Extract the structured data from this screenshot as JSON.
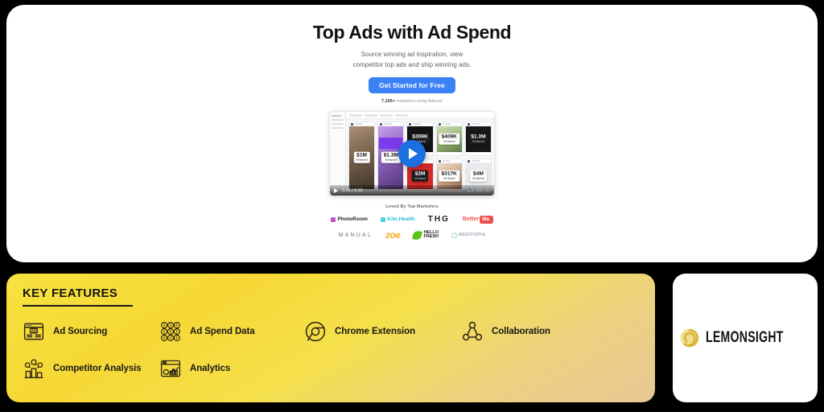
{
  "hero": {
    "title": "Top Ads with Ad Spend",
    "subtitle_line1": "Source winning ad inspiration, view",
    "subtitle_line2": "competitor top ads and ship winning ads.",
    "cta_label": "Get Started for Free",
    "social_proof_count": "7,100+",
    "social_proof_text": " marketers using Adscan",
    "accent_color": "#3b82f6"
  },
  "video": {
    "play_label": "Play",
    "current_time": "0:00",
    "duration": "6:32",
    "time_display": "0:00 / 6:32",
    "volume_icon": "volume-icon",
    "fullscreen_icon": "fullscreen-icon",
    "settings_icon": "more-options-icon",
    "ad_cards": [
      {
        "amount": "$1M",
        "label": "Ad Spend"
      },
      {
        "amount": "$1.3M",
        "label": "Ad Spend"
      },
      {
        "amount": "$309K",
        "label": "Ad Spend"
      },
      {
        "amount": "$409K",
        "label": "Ad Spend"
      },
      {
        "amount": "$1.3M",
        "label": "Ad Spend"
      },
      {
        "amount": "$2M",
        "label": "Ad Spend"
      },
      {
        "amount": "$317K",
        "label": "Ad Spend"
      },
      {
        "amount": "$4M",
        "label": "Ad Spend"
      }
    ]
  },
  "social": {
    "heading": "Loved By Top Marketers",
    "row1": [
      {
        "name": "PhotoRoom",
        "icon": "photoroom-logo"
      },
      {
        "name": "Kilo.Health",
        "icon": "kilohealth-logo"
      },
      {
        "name": "THG",
        "icon": "thg-logo"
      },
      {
        "name": "Better",
        "badge": "Me.",
        "icon": "betterme-logo"
      }
    ],
    "row2": [
      {
        "name": "MANUAL",
        "icon": "manual-logo"
      },
      {
        "name": "zoe",
        "icon": "zoe-logo"
      },
      {
        "name": "HELLO",
        "name2": "FRESH",
        "icon": "hellofresh-logo"
      },
      {
        "name": "MEDITOPIA",
        "icon": "meditopia-logo"
      }
    ]
  },
  "features": {
    "heading": "KEY FEATURES",
    "items": [
      {
        "label": "Ad Sourcing",
        "icon": "ad-window-icon"
      },
      {
        "label": "Ad Spend Data",
        "icon": "coins-grid-icon"
      },
      {
        "label": "Chrome Extension",
        "icon": "chrome-icon"
      },
      {
        "label": "Collaboration",
        "icon": "collaboration-icon"
      },
      {
        "label": "Competitor Analysis",
        "icon": "competitor-chart-icon"
      },
      {
        "label": "Analytics",
        "icon": "analytics-window-icon"
      }
    ],
    "gradient_from": "#f7e23f",
    "gradient_to": "#e8c896"
  },
  "brand": {
    "name": "LEMONSIGHT",
    "mark_icon": "lemon-spiral-icon",
    "mark_color": "#e8c84a"
  }
}
